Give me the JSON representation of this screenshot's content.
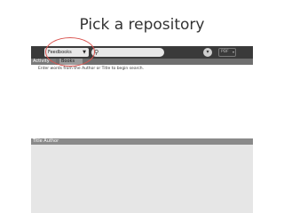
{
  "slide": {
    "title": "Pick a repository"
  },
  "toolbar": {
    "repository_value": "Feedbooks",
    "search_placeholder": "",
    "format_value": "PDF"
  },
  "tabs": [
    {
      "label": "Activity"
    },
    {
      "label": "Books"
    }
  ],
  "search": {
    "hint": "Enter words from the Author or Title to begin search."
  },
  "results": {
    "columns": [
      "Title",
      "Author"
    ],
    "header_text": "Title  Author"
  }
}
